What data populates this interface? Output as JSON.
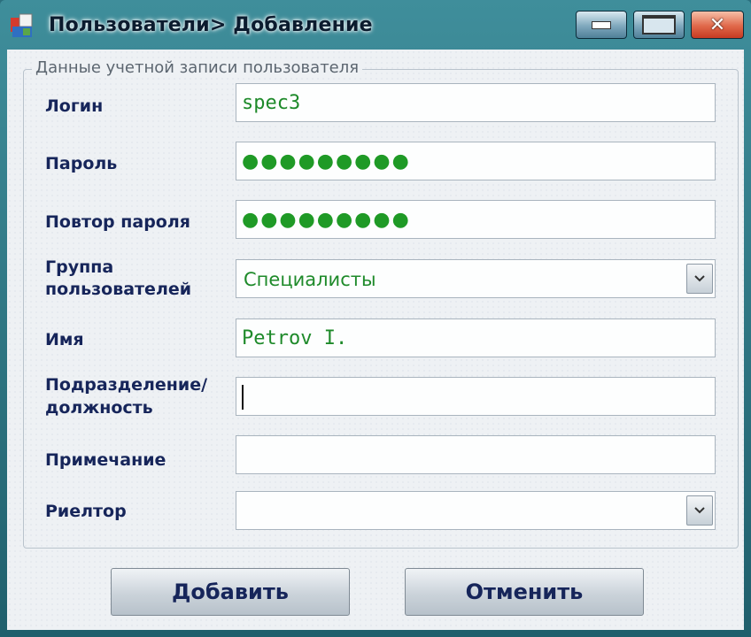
{
  "window": {
    "title": "Пользователи> Добавление",
    "controls": {
      "minimize": "minimize-icon",
      "maximize": "maximize-icon",
      "close": "close-icon"
    }
  },
  "group": {
    "legend": "Данные учетной записи пользователя"
  },
  "fields": {
    "login": {
      "label": "Логин",
      "value": "spec3"
    },
    "password": {
      "label": "Пароль",
      "value": "●●●●●●●●●"
    },
    "password_repeat": {
      "label": "Повтор пароля",
      "value": "●●●●●●●●●"
    },
    "user_group": {
      "label_line1": "Группа",
      "label_line2": "пользователей",
      "value": "Специалисты"
    },
    "name": {
      "label": "Имя",
      "value": "Petrov I."
    },
    "department": {
      "label_line1": "Подразделение/",
      "label_line2": "должность",
      "value": ""
    },
    "note": {
      "label": "Примечание",
      "value": ""
    },
    "realtor": {
      "label": "Риелтор",
      "value": ""
    }
  },
  "buttons": {
    "add": "Добавить",
    "cancel": "Отменить"
  },
  "colors": {
    "title_bar": "#2f7c8a",
    "value_text": "#1e8a2a",
    "label_text": "#16255a",
    "close_button": "#d9553a"
  }
}
